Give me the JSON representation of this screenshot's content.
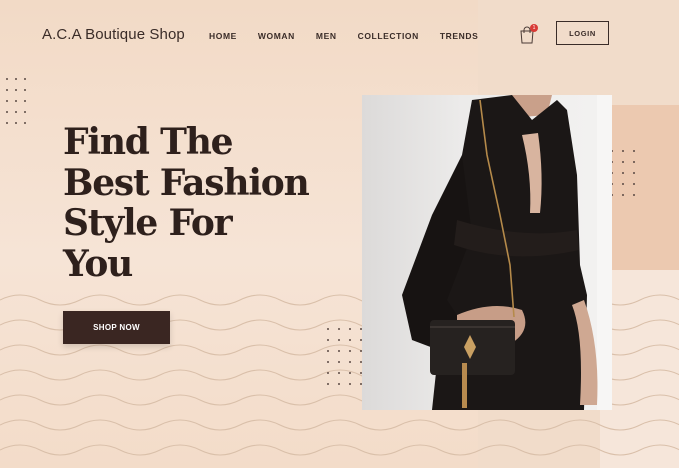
{
  "brand": {
    "name": "A.C.A Boutique Shop"
  },
  "nav": {
    "items": [
      {
        "label": "HOME"
      },
      {
        "label": "WOMAN"
      },
      {
        "label": "MEN"
      },
      {
        "label": "COLLECTION"
      },
      {
        "label": "TRENDS"
      }
    ]
  },
  "cart": {
    "icon": "shopping-bag-icon",
    "badge_count": "1"
  },
  "auth": {
    "login_label": "LOGIN"
  },
  "hero": {
    "headline_lines": [
      "Find The",
      "Best Fashion",
      "Style For",
      "You"
    ],
    "cta_label": "SHOP NOW",
    "image": "woman-black-dress-with-handbag"
  },
  "colors": {
    "background": "#f5e3d3",
    "text_dark": "#2e201c",
    "button": "#3a2622",
    "badge": "#d93a35",
    "accent_block": "#ecc9b0"
  }
}
